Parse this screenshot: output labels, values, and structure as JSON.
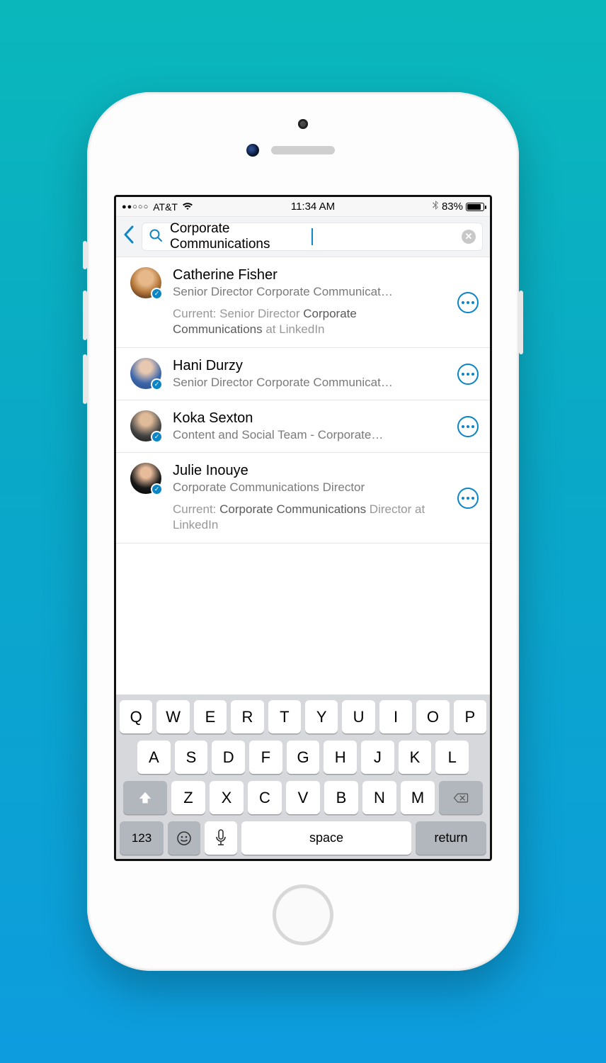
{
  "statusbar": {
    "signal_dots": "●●○○○",
    "carrier": "AT&T",
    "time": "11:34 AM",
    "battery_pct": "83%"
  },
  "search": {
    "value": "Corporate Communications"
  },
  "results": [
    {
      "name": "Catherine Fisher",
      "title": "Senior Director Corporate Communicat…",
      "current_prefix": "Current: Senior Director ",
      "current_hl": "Corporate Communications",
      "current_suffix": " at LinkedIn",
      "has_current": true
    },
    {
      "name": "Hani Durzy",
      "title": "Senior Director Corporate Communicat…",
      "has_current": false
    },
    {
      "name": "Koka Sexton",
      "title": "Content and Social Team - Corporate…",
      "has_current": false
    },
    {
      "name": "Julie Inouye",
      "title": "Corporate Communications Director",
      "current_prefix": "Current: ",
      "current_hl": "Corporate Communications",
      "current_suffix": " Director at LinkedIn",
      "has_current": true
    }
  ],
  "keyboard": {
    "row1": [
      "Q",
      "W",
      "E",
      "R",
      "T",
      "Y",
      "U",
      "I",
      "O",
      "P"
    ],
    "row2": [
      "A",
      "S",
      "D",
      "F",
      "G",
      "H",
      "J",
      "K",
      "L"
    ],
    "row3_letters": [
      "Z",
      "X",
      "C",
      "V",
      "B",
      "N",
      "M"
    ],
    "n123": "123",
    "space": "space",
    "ret": "return"
  }
}
